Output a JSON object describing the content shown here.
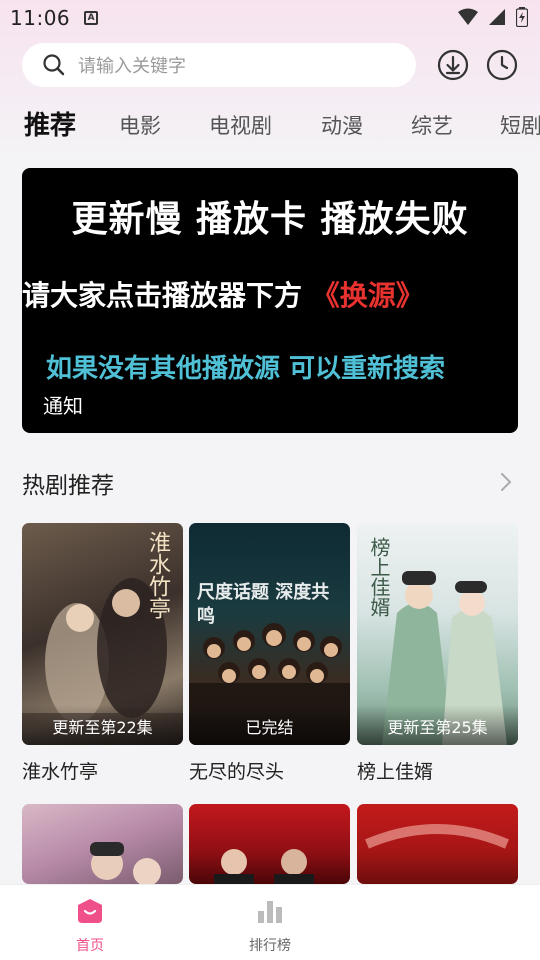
{
  "status_bar": {
    "time": "11:06",
    "notification_icon": "A"
  },
  "search": {
    "placeholder": "请输入关键字"
  },
  "tabs": [
    {
      "label": "推荐",
      "active": true
    },
    {
      "label": "电影",
      "active": false
    },
    {
      "label": "电视剧",
      "active": false
    },
    {
      "label": "动漫",
      "active": false
    },
    {
      "label": "综艺",
      "active": false
    },
    {
      "label": "短剧",
      "active": false
    }
  ],
  "banner": {
    "line1": "更新慢 播放卡 播放失败",
    "line2_prefix": "请大家点击播放器下方 ",
    "line2_highlight": "《换源》",
    "line3": "如果没有其他播放源 可以重新搜索",
    "label": "通知"
  },
  "section": {
    "title": "热剧推荐"
  },
  "cards": [
    {
      "title": "淮水竹亭",
      "status": "更新至第22集",
      "art": "淮水竹亭"
    },
    {
      "title": "无尽的尽头",
      "status": "已完结",
      "art": "尺度话题 深度共鸣"
    },
    {
      "title": "榜上佳婿",
      "status": "更新至第25集",
      "art": "榜上佳婿"
    }
  ],
  "bottom_nav": [
    {
      "label": "首页",
      "active": true
    },
    {
      "label": "排行榜",
      "active": false
    }
  ],
  "colors": {
    "accent": "#f0508a",
    "banner_highlight": "#e8322f",
    "banner_cyan": "#4fc0d6"
  }
}
